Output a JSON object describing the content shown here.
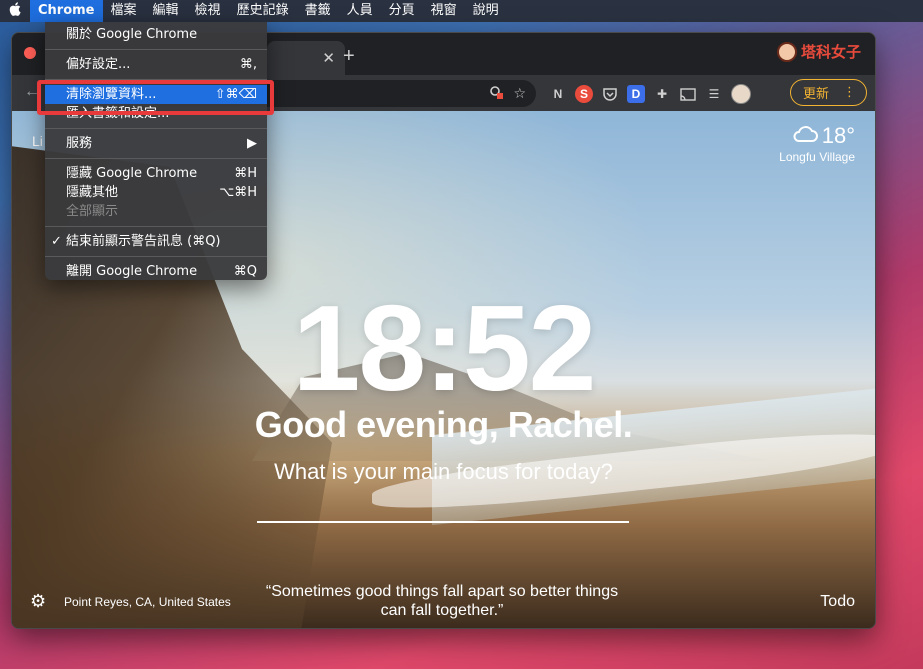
{
  "menubar": {
    "items": [
      "Chrome",
      "檔案",
      "編輯",
      "檢視",
      "歷史記錄",
      "書籤",
      "人員",
      "分頁",
      "視窗",
      "說明"
    ]
  },
  "chrome_menu": {
    "about": "關於 Google Chrome",
    "preferences": {
      "label": "偏好設定...",
      "shortcut": "⌘,"
    },
    "clear_data": {
      "label": "清除瀏覽資料...",
      "shortcut": "⇧⌘⌫"
    },
    "import": "匯入書籤和設定...",
    "services": "服務",
    "hide_chrome": {
      "label": "隱藏 Google Chrome",
      "shortcut": "⌘H"
    },
    "hide_others": {
      "label": "隱藏其他",
      "shortcut": "⌥⌘H"
    },
    "show_all": "全部顯示",
    "warn_before_quit": "結束前顯示警告訊息 (⌘Q)",
    "quit": {
      "label": "離開 Google Chrome",
      "shortcut": "⌘Q"
    }
  },
  "browser": {
    "brand_text": "塔科女子",
    "update_label": "更新",
    "extensions": [
      "N",
      "S",
      "D"
    ]
  },
  "newtab": {
    "links_label": "Li",
    "weather": {
      "temp": "18°",
      "location": "Longfu Village"
    },
    "time": "18:52",
    "greeting": "Good evening, Rachel.",
    "focus_question": "What is your main focus for today?",
    "photo_location": "Point Reyes, CA, United States",
    "quote_line1": "“Sometimes good things fall apart so better things",
    "quote_line2": "can fall together.”",
    "todo": "Todo"
  },
  "colors": {
    "menu_highlight": "#1f6fe0",
    "annotation_red": "#e83a3a",
    "update_accent": "#f2b431"
  }
}
